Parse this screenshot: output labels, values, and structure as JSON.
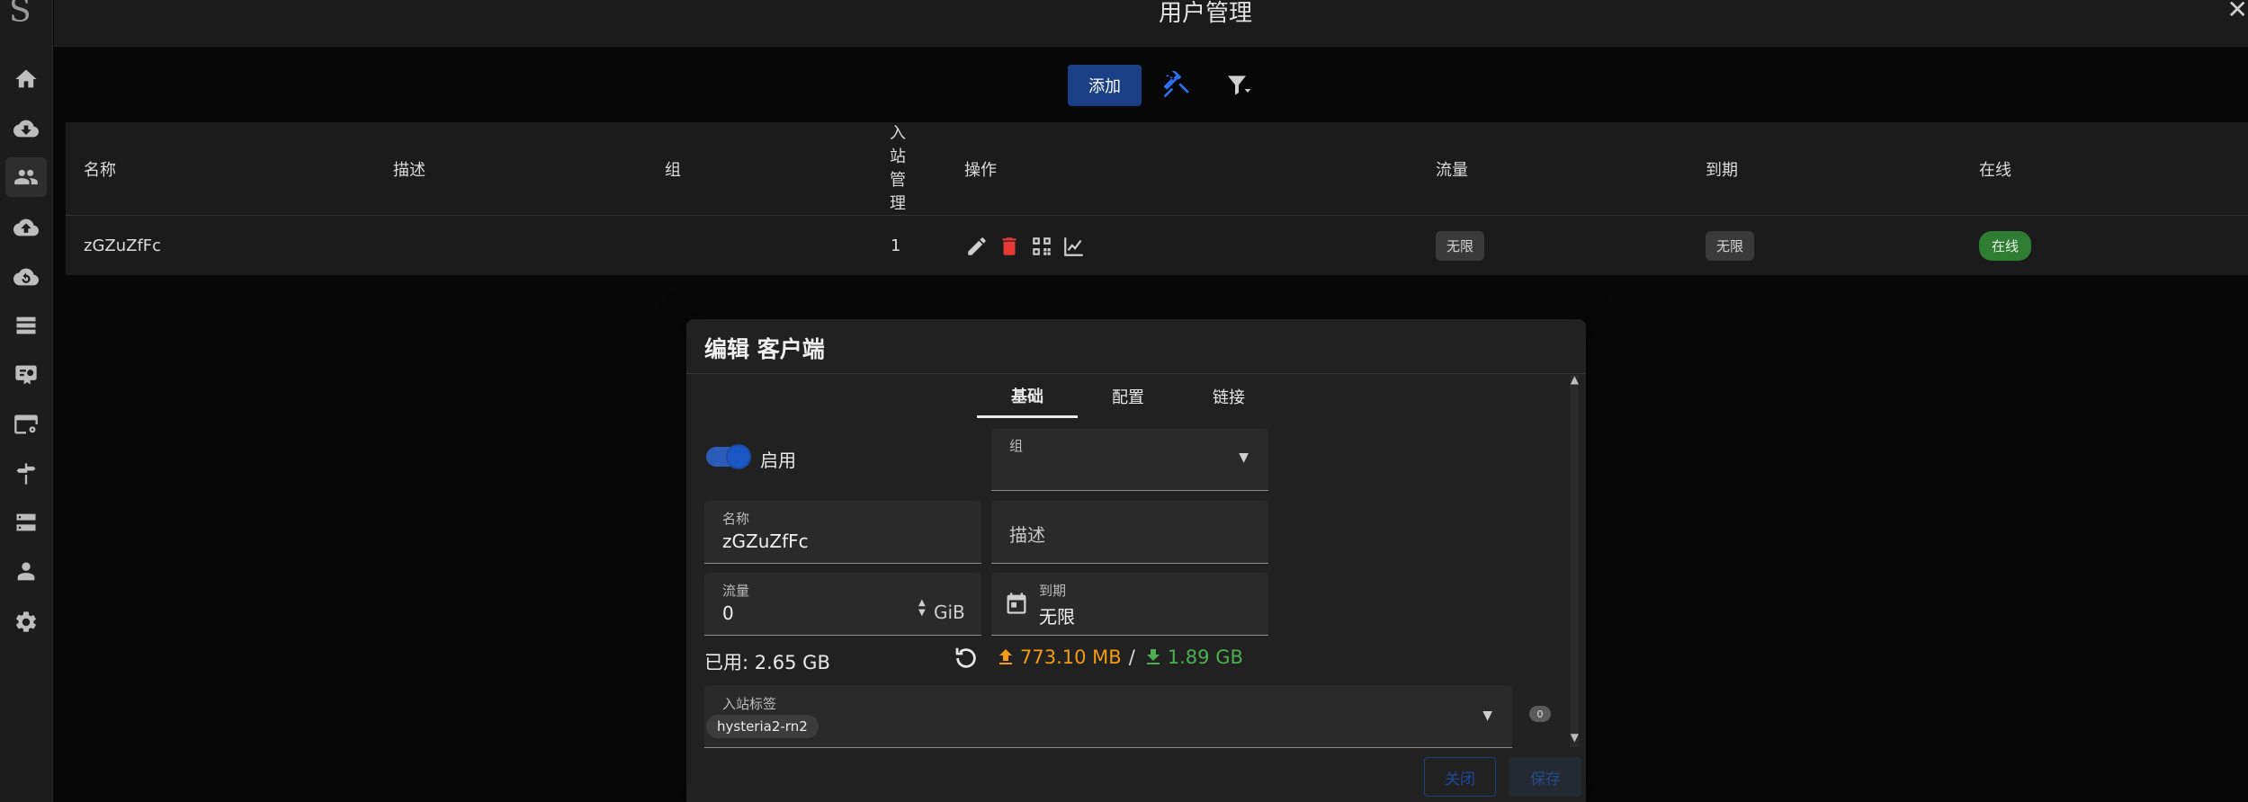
{
  "app": {
    "logo_letter": "S",
    "page_title": "用户管理",
    "top_right_icon": "close-icon"
  },
  "sidebar": {
    "items": [
      {
        "id": "home",
        "icon": "home-icon"
      },
      {
        "id": "inbounds",
        "icon": "cloud-download-icon"
      },
      {
        "id": "clients",
        "icon": "people-icon",
        "active": true
      },
      {
        "id": "outbounds",
        "icon": "cloud-upload-icon"
      },
      {
        "id": "services",
        "icon": "cloud-sync-icon"
      },
      {
        "id": "rules",
        "icon": "list-icon"
      },
      {
        "id": "tls",
        "icon": "certificate-icon"
      },
      {
        "id": "dns",
        "icon": "web-gear-icon"
      },
      {
        "id": "routing",
        "icon": "signpost-icon"
      },
      {
        "id": "server",
        "icon": "server-icon"
      },
      {
        "id": "admins",
        "icon": "admin-icon"
      },
      {
        "id": "settings",
        "icon": "settings-icon"
      }
    ]
  },
  "toolbar": {
    "add_label": "添加",
    "tools_icon": "tools-icon",
    "filter_icon": "filter-icon"
  },
  "table": {
    "headers": {
      "name": "名称",
      "desc": "描述",
      "group": "组",
      "inbound_chars": [
        "入",
        "站",
        "管",
        "理"
      ],
      "actions": "操作",
      "traffic": "流量",
      "expiry": "到期",
      "online": "在线"
    },
    "rows": [
      {
        "name": "zGZuZfFc",
        "desc": "",
        "group": "",
        "inbound": "1",
        "traffic": "无限",
        "expiry": "无限",
        "online": "在线"
      }
    ]
  },
  "dialog": {
    "title": "编辑 客户端",
    "tabs": [
      "基础",
      "配置",
      "链接"
    ],
    "active_tab": "基础",
    "enable_label": "启用",
    "enabled": true,
    "group": {
      "label": "组",
      "value": ""
    },
    "name": {
      "label": "名称",
      "value": "zGZuZfFc"
    },
    "description": {
      "placeholder": "描述"
    },
    "volume": {
      "label": "流量",
      "value": "0",
      "unit": "GiB"
    },
    "expiry": {
      "label": "到期",
      "value": "无限"
    },
    "used_label": "已用: 2.65 GB",
    "upload": "773.10 MB",
    "download": "1.89 GB",
    "slash": "/",
    "inbound_tags": {
      "label": "入站标签",
      "tags": [
        "hysteria2-rn2"
      ],
      "count": "0"
    },
    "close_label": "关闭",
    "save_label": "保存"
  },
  "colors": {
    "accent": "#1a3f84",
    "danger": "#e53935",
    "online": "#2e7d32",
    "upload": "#f39c12",
    "download": "#4caf50"
  }
}
